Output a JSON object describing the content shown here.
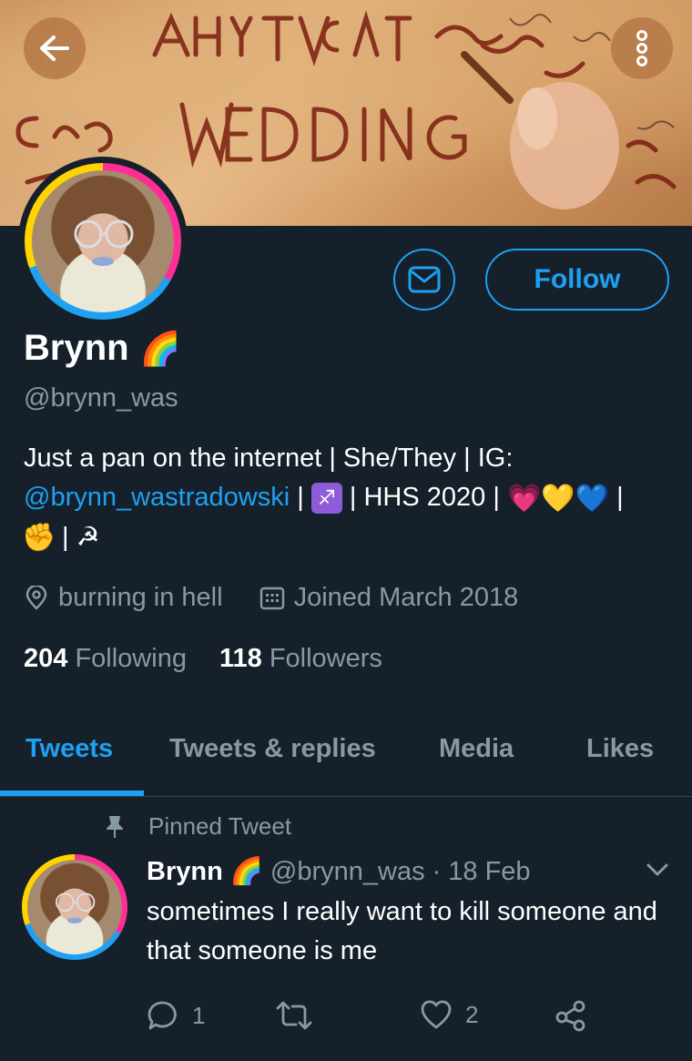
{
  "header": {
    "back_icon": "arrow-left-icon",
    "more_icon": "more-vertical-icon"
  },
  "profile": {
    "name": "Brynn",
    "name_emoji": "🌈",
    "handle": "@brynn_was",
    "follow_label": "Follow",
    "message_icon": "envelope-icon",
    "bio": {
      "line1": "Just a pan on the internet | She/They | IG:",
      "ig_link": "@brynn_wastradowski",
      "sep1": " | ",
      "sagittarius": "♐",
      "hhs": " | HHS 2020 | ",
      "hearts": [
        "💗",
        "💛",
        "💙"
      ],
      "sep2": " |",
      "fist": "✊",
      "sep3": " | ",
      "sickle": "☭"
    },
    "location": "burning in hell",
    "joined": "Joined March 2018",
    "following_count": "204",
    "following_label": "Following",
    "followers_count": "118",
    "followers_label": "Followers"
  },
  "tabs": [
    {
      "label": "Tweets",
      "active": true
    },
    {
      "label": "Tweets & replies",
      "active": false
    },
    {
      "label": "Media",
      "active": false
    },
    {
      "label": "Likes",
      "active": false
    }
  ],
  "pinned_tweet": {
    "pinned_label": "Pinned Tweet",
    "author": "Brynn",
    "author_emoji": "🌈",
    "handle": "@brynn_was",
    "date": "18 Feb",
    "text": "sometimes I really want to kill someone and that someone is me",
    "reply_count": "1",
    "like_count": "2"
  },
  "colors": {
    "background": "#15202b",
    "accent": "#1da1f2",
    "muted": "#8899a6"
  }
}
